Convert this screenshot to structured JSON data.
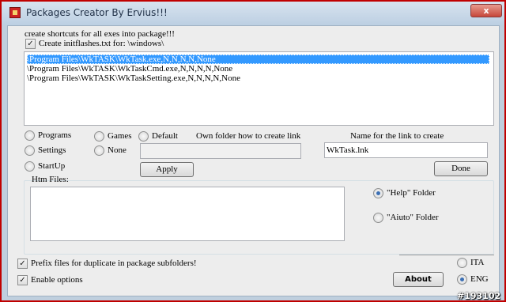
{
  "window": {
    "title": "Packages Creator By Ervius!!!",
    "close_symbol": "x"
  },
  "header": {
    "section_label": "create shortcuts for all exes into package!!!",
    "initflashes_label": "Create initflashes.txt for: \\windows\\",
    "initflashes_checked": true
  },
  "exe_list": [
    {
      "text": "\\Program Files\\WkTASK\\WkTask.exe,N,N,N,N,None",
      "selected": true
    },
    {
      "text": "\\Program Files\\WkTASK\\WkTaskCmd.exe,N,N,N,N,None",
      "selected": false
    },
    {
      "text": "\\Program Files\\WkTASK\\WkTaskSetting.exe,N,N,N,N,None",
      "selected": false
    }
  ],
  "location": {
    "programs": "Programs",
    "settings": "Settings",
    "startup": "StartUp",
    "games": "Games",
    "none": "None",
    "default": "Default"
  },
  "own_folder": {
    "label": "Own folder how to create link",
    "value": ""
  },
  "link_name": {
    "label": "Name for the link to create",
    "value": "WkTask.lnk"
  },
  "buttons": {
    "apply": "Apply",
    "done": "Done",
    "about": "About"
  },
  "htm": {
    "label": "Htm Files:",
    "help_folder": "\"Help\" Folder",
    "auto_folder": "\"Aiuto\" Folder",
    "selected": "help"
  },
  "options": {
    "prefix_label": "Prefix  files for duplicate in package subfolders!",
    "prefix_checked": true,
    "enable_label": "Enable options",
    "enable_checked": true
  },
  "language": {
    "ita": "ITA",
    "eng": "ENG",
    "selected": "ENG"
  },
  "watermark": "#193102"
}
